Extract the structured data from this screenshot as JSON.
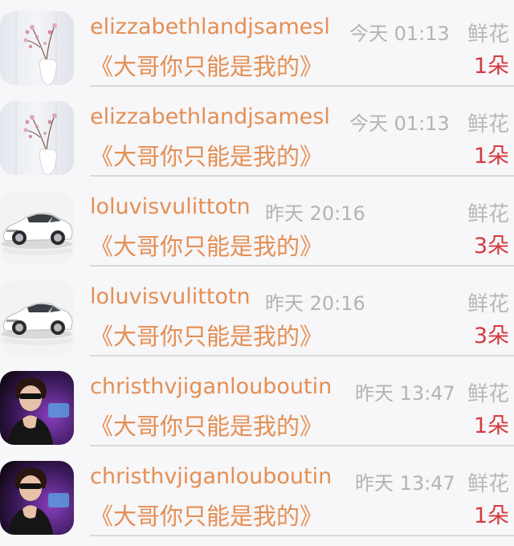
{
  "rows": [
    {
      "name": "elizzabethlandjsamesl",
      "time": "今天 01:13",
      "gift": "鲜花",
      "message": "《大哥你只能是我的》",
      "count": "1朵",
      "avatar": "flower-vase-avatar"
    },
    {
      "name": "elizzabethlandjsamesl",
      "time": "今天 01:13",
      "gift": "鲜花",
      "message": "《大哥你只能是我的》",
      "count": "1朵",
      "avatar": "flower-vase-avatar"
    },
    {
      "name": "loluvisvulittotn",
      "time": "昨天 20:16",
      "gift": "鲜花",
      "message": "《大哥你只能是我的》",
      "count": "3朵",
      "avatar": "white-car-avatar"
    },
    {
      "name": "loluvisvulittotn",
      "time": "昨天 20:16",
      "gift": "鲜花",
      "message": "《大哥你只能是我的》",
      "count": "3朵",
      "avatar": "white-car-avatar"
    },
    {
      "name": "christhvjiganlouboutin",
      "time": "昨天 13:47",
      "gift": "鲜花",
      "message": "《大哥你只能是我的》",
      "count": "1朵",
      "avatar": "person-sunglasses-avatar"
    },
    {
      "name": "christhvjiganlouboutin",
      "time": "昨天 13:47",
      "gift": "鲜花",
      "message": "《大哥你只能是我的》",
      "count": "1朵",
      "avatar": "person-sunglasses-avatar"
    }
  ],
  "colors": {
    "accent": "#e48f54",
    "count": "#d43a3e",
    "muted": "#b4b4b4",
    "background": "#f7f6f8"
  }
}
